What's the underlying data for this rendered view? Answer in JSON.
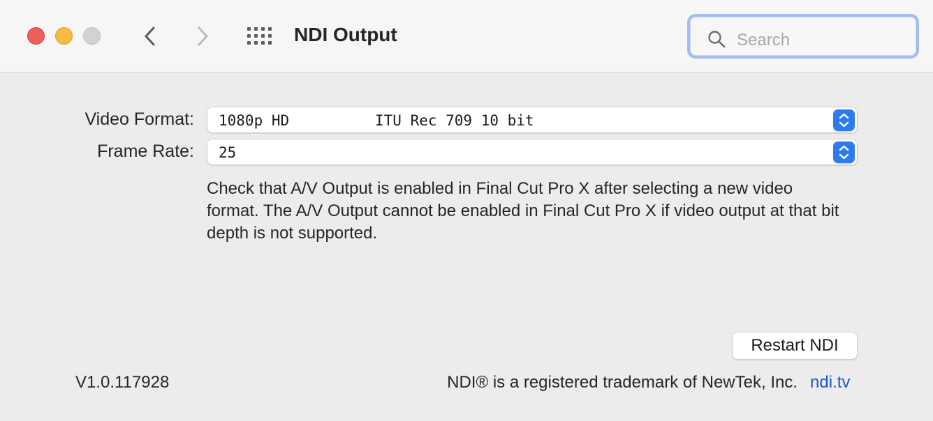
{
  "window": {
    "title": "NDI Output"
  },
  "toolbar": {
    "back_icon": "chevron-left-icon",
    "forward_icon": "chevron-right-icon",
    "grid_icon": "grid-icon",
    "search_placeholder": "Search"
  },
  "form": {
    "video_format_label": "Video Format:",
    "video_format_value_left": "1080p HD",
    "video_format_value_right": "ITU Rec 709 10 bit",
    "frame_rate_label": "Frame Rate:",
    "frame_rate_value": "25"
  },
  "note": "Check that A/V Output is enabled in Final Cut Pro X after selecting a new video format. The A/V Output cannot be enabled in Final Cut Pro X if video output at that bit depth is not supported.",
  "buttons": {
    "restart_label": "Restart NDI"
  },
  "footer": {
    "version": "V1.0.117928",
    "trademark": "NDI® is a registered trademark of NewTek, Inc.",
    "link": "ndi.tv"
  },
  "colors": {
    "accent": "#2e7bf0",
    "link": "#1f55c8",
    "close": "#ee5f57",
    "minimize": "#f5bd40",
    "zoom_disabled": "#d2d2d2"
  }
}
